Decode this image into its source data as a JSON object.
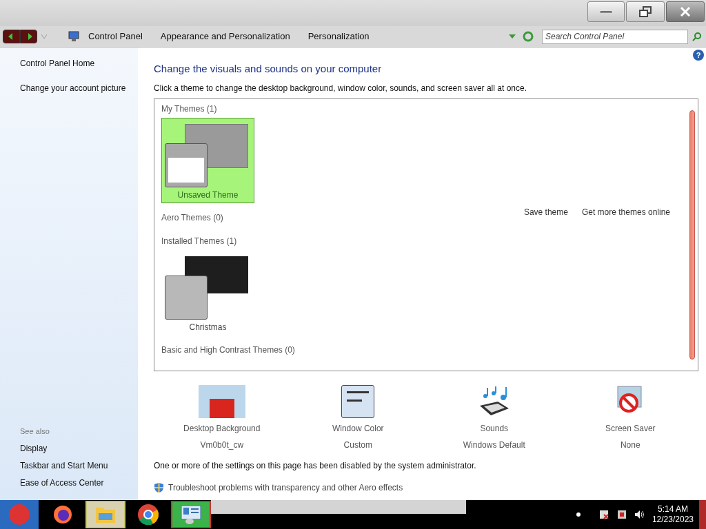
{
  "breadcrumbs": [
    "Control Panel",
    "Appearance and Personalization",
    "Personalization"
  ],
  "search": {
    "placeholder": "Search Control Panel"
  },
  "help": "?",
  "sidebar": {
    "links": [
      "Control Panel Home",
      "Change your account picture"
    ],
    "see_also_label": "See also",
    "see_also": [
      "Display",
      "Taskbar and Start Menu",
      "Ease of Access Center"
    ]
  },
  "heading": "Change the visuals and sounds on your computer",
  "instructions": "Click a theme to change the desktop background, window color, sounds, and screen saver all at once.",
  "theme_groups": [
    {
      "title": "My Themes (1)",
      "themes": [
        {
          "name": "Unsaved Theme",
          "kind": "comic",
          "selected": true
        }
      ],
      "actions": [
        "Save theme",
        "Get more themes online"
      ]
    },
    {
      "title": "Aero Themes (0)"
    },
    {
      "title": "Installed Themes (1)",
      "themes": [
        {
          "name": "Christmas",
          "kind": "dark",
          "selected": false
        }
      ]
    },
    {
      "title": "Basic and High Contrast Themes (0)"
    }
  ],
  "settings": [
    {
      "kind": "background",
      "label": "Desktop Background",
      "value": "Vm0b0t_cw"
    },
    {
      "kind": "color",
      "label": "Window Color",
      "value": "Custom"
    },
    {
      "kind": "sounds",
      "label": "Sounds",
      "value": "Windows Default"
    },
    {
      "kind": "screensaver",
      "label": "Screen Saver",
      "value": "None"
    }
  ],
  "notice": "One or more of the settings on this page has been disabled by the system administrator.",
  "troubleshoot": "Troubleshoot problems with transparency and other Aero effects",
  "taskbar": {
    "apps": [
      {
        "kind": "firefox",
        "selected": false
      },
      {
        "kind": "explorer",
        "selected": true
      },
      {
        "kind": "chrome",
        "selected": false
      },
      {
        "kind": "controlpanel",
        "selected": true
      }
    ],
    "time": "5:14 AM",
    "date": "12/23/2023"
  }
}
